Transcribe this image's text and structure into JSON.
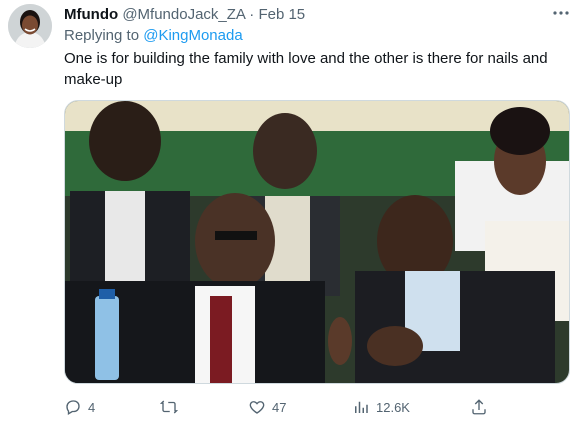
{
  "tweet": {
    "display_name": "Mfundo",
    "handle": "@MfundoJack_ZA",
    "separator": "·",
    "date": "Feb 15",
    "more_icon": "more-horizontal-icon",
    "replying_prefix": "Replying to",
    "replying_to": "@KingMonada",
    "text": "One is for building the family with love and the other is there for nails and make-up",
    "media": {
      "type": "photo"
    }
  },
  "actions": {
    "reply_count": "4",
    "retweet_count": "",
    "like_count": "47",
    "view_count": "12.6K"
  },
  "colors": {
    "link": "#1d9bf0",
    "muted": "#536471",
    "text": "#0f1419"
  }
}
